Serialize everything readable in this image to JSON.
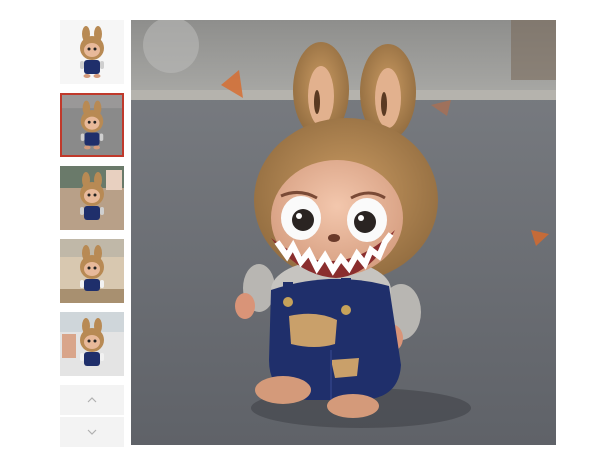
{
  "gallery": {
    "thumbnails": [
      {
        "name": "thumb-studio",
        "background": "#f6f6f6",
        "selected": false
      },
      {
        "name": "thumb-street",
        "background": "#8a8a8a",
        "selected": true
      },
      {
        "name": "thumb-shop",
        "background": "#b8a088",
        "selected": false
      },
      {
        "name": "thumb-kitchen",
        "background": "#d8c8b0",
        "selected": false
      },
      {
        "name": "thumb-interior",
        "background": "#e4e4e4",
        "selected": false
      }
    ],
    "nav": {
      "up_icon": "chevron-up-icon",
      "down_icon": "chevron-down-icon"
    },
    "colors": {
      "selected_border": "#c0392b",
      "nav_background": "#f3f3f3",
      "fur": "#b88a54",
      "overalls": "#1f2f6b",
      "asphalt": "#6f7278"
    }
  }
}
